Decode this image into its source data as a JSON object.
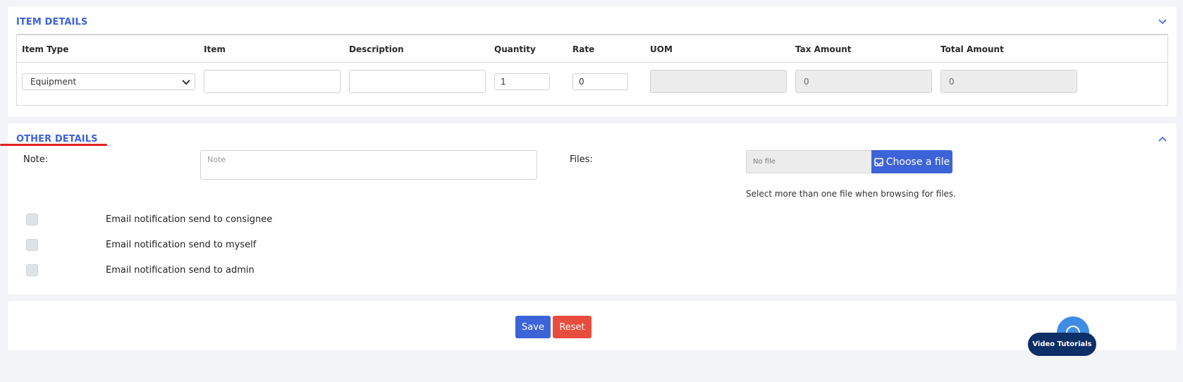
{
  "item_details": {
    "title": "ITEM DETAILS",
    "columns": [
      "Item Type",
      "Item",
      "Description",
      "Quantity",
      "Rate",
      "UOM",
      "Tax Amount",
      "Total Amount"
    ],
    "row": {
      "item_type": "Equipment",
      "item": "",
      "description": "",
      "quantity": "1",
      "rate": "0",
      "uom": "",
      "tax_amount": "0",
      "total_amount": "0"
    }
  },
  "other_details": {
    "title": "OTHER DETAILS",
    "note_label": "Note:",
    "note_placeholder": "Note",
    "files_label": "Files:",
    "file_status": "No file",
    "choose_file_label": "Choose a file",
    "files_hint": "Select more than one file when browsing for files.",
    "checkboxes": [
      {
        "label": "Email notification send to consignee",
        "checked": false
      },
      {
        "label": "Email notification send to myself",
        "checked": false
      },
      {
        "label": "Email notification send to admin",
        "checked": false
      }
    ]
  },
  "actions": {
    "save_label": "Save",
    "reset_label": "Reset"
  },
  "help": {
    "video_tutorials_label": "Video Tutorials"
  },
  "colors": {
    "accent": "#3d63d8",
    "danger": "#e74c3c",
    "pill": "#0d2f67",
    "bubble": "#3f8ce5"
  }
}
